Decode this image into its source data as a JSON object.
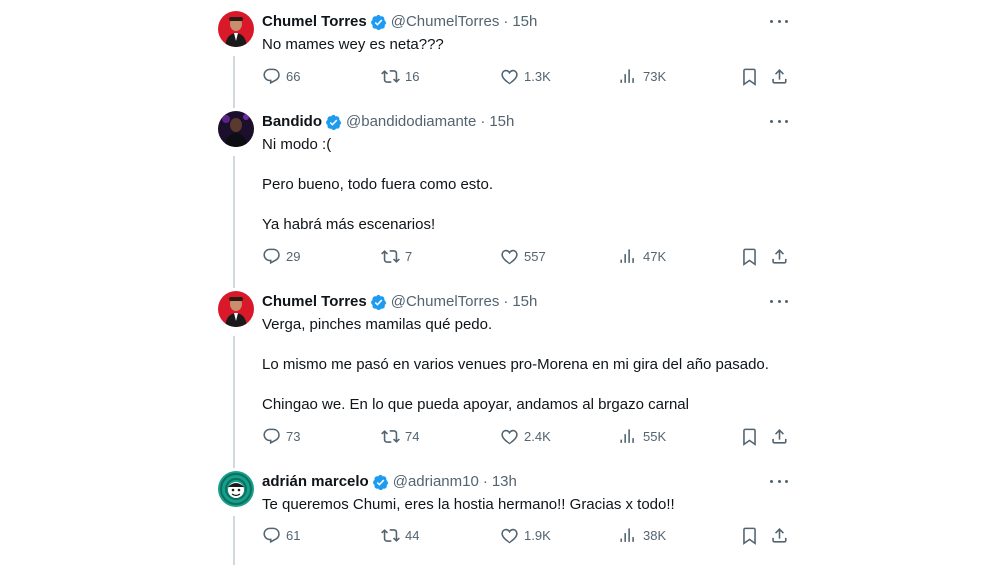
{
  "colors": {
    "text": "#0f1419",
    "secondary": "#536471",
    "verified": "#1d9bf0",
    "thread_line": "#cfd9de"
  },
  "tweets": [
    {
      "display_name": "Chumel Torres",
      "handle": "@ChumelTorres",
      "separator": "·",
      "time": "15h",
      "avatar_icon": "chumel-avatar",
      "body": [
        "No mames wey es neta???"
      ],
      "replies": "66",
      "retweets": "16",
      "likes": "1.3K",
      "views": "73K"
    },
    {
      "display_name": "Bandido",
      "handle": "@bandidodiamante",
      "separator": "·",
      "time": "15h",
      "avatar_icon": "bandido-avatar",
      "body": [
        "Ni modo :(",
        "Pero bueno, todo fuera como esto.",
        "Ya habrá más escenarios!"
      ],
      "replies": "29",
      "retweets": "7",
      "likes": "557",
      "views": "47K"
    },
    {
      "display_name": "Chumel Torres",
      "handle": "@ChumelTorres",
      "separator": "·",
      "time": "15h",
      "avatar_icon": "chumel-avatar",
      "body": [
        "Verga, pinches mamilas qué pedo.",
        "Lo mismo me pasó en varios venues pro-Morena en mi gira del año pasado.",
        "Chingao we. En lo que pueda apoyar, andamos al brgazo carnal"
      ],
      "replies": "73",
      "retweets": "74",
      "likes": "2.4K",
      "views": "55K"
    },
    {
      "display_name": "adrián marcelo",
      "handle": "@adrianm10",
      "separator": "·",
      "time": "13h",
      "avatar_icon": "adrian-avatar",
      "body": [
        "Te queremos Chumi, eres la hostia hermano!! Gracias x todo!!"
      ],
      "replies": "61",
      "retweets": "44",
      "likes": "1.9K",
      "views": "38K"
    }
  ]
}
